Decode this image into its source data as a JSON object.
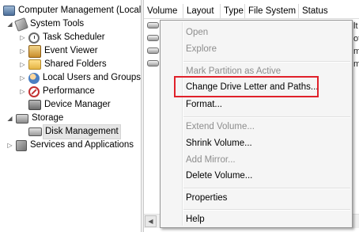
{
  "tree": {
    "items": [
      {
        "label": "Computer Management (Local",
        "icon": "computer-icon",
        "expander": ""
      },
      {
        "label": "System Tools",
        "icon": "tools-icon",
        "expander": "◢"
      },
      {
        "label": "Task Scheduler",
        "icon": "clock-icon",
        "expander": "▷"
      },
      {
        "label": "Event Viewer",
        "icon": "event-viewer-icon",
        "expander": "▷"
      },
      {
        "label": "Shared Folders",
        "icon": "folder-icon",
        "expander": "▷"
      },
      {
        "label": "Local Users and Groups",
        "icon": "users-icon",
        "expander": "▷"
      },
      {
        "label": "Performance",
        "icon": "performance-icon",
        "expander": "▷"
      },
      {
        "label": "Device Manager",
        "icon": "device-manager-icon",
        "expander": ""
      },
      {
        "label": "Storage",
        "icon": "storage-icon",
        "expander": "◢"
      },
      {
        "label": "Disk Management",
        "icon": "disk-icon",
        "expander": ""
      },
      {
        "label": "Services and Applications",
        "icon": "services-icon",
        "expander": "▷"
      }
    ]
  },
  "list": {
    "columns": [
      "Volume",
      "Layout",
      "Type",
      "File System",
      "Status"
    ],
    "row_edge_text": [
      "lt",
      "ot",
      "m",
      "m"
    ]
  },
  "context_menu": {
    "items": [
      {
        "label": "Open",
        "enabled": false
      },
      {
        "label": "Explore",
        "enabled": false
      },
      {
        "label": "Mark Partition as Active",
        "enabled": false
      },
      {
        "label": "Change Drive Letter and Paths...",
        "enabled": true,
        "highlighted": true
      },
      {
        "label": "Format...",
        "enabled": true
      },
      {
        "label": "Extend Volume...",
        "enabled": false
      },
      {
        "label": "Shrink Volume...",
        "enabled": true
      },
      {
        "label": "Add Mirror...",
        "enabled": false
      },
      {
        "label": "Delete Volume...",
        "enabled": true
      },
      {
        "label": "Properties",
        "enabled": true
      },
      {
        "label": "Help",
        "enabled": true
      }
    ]
  },
  "colors": {
    "highlight_box": "#e0212a",
    "menu_background": "#f5f5f5",
    "disabled_text": "#8d8d8d"
  }
}
